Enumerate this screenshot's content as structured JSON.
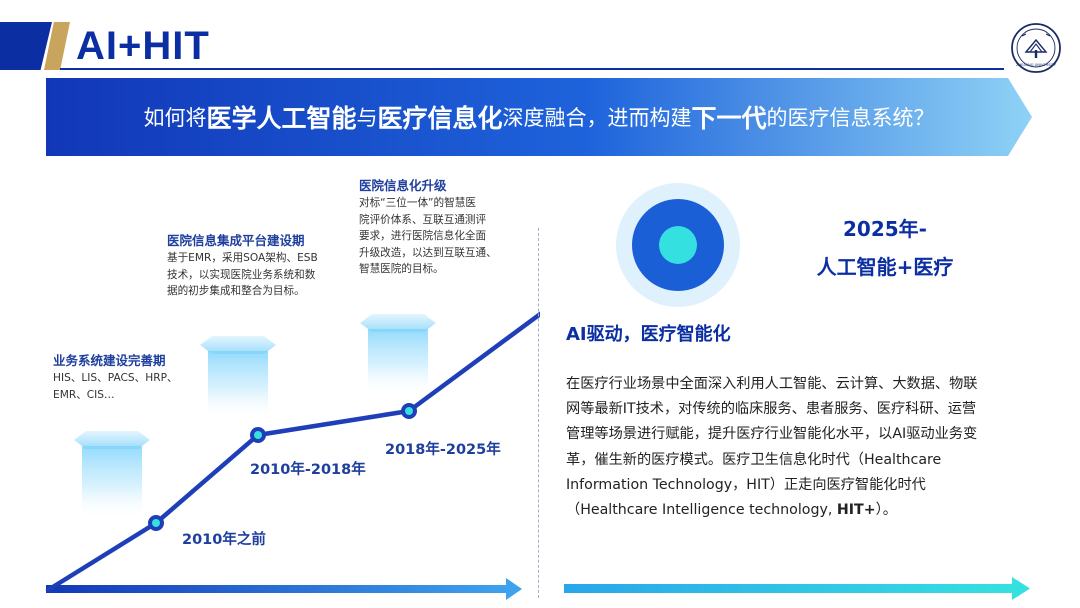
{
  "header": {
    "title": "AI+HIT",
    "logo_text": "ZHEJIANG UNIVERSITY"
  },
  "banner": {
    "parts": [
      {
        "text": "如何将",
        "strong": false
      },
      {
        "text": "医学人工智能",
        "strong": true
      },
      {
        "text": "与",
        "strong": false
      },
      {
        "text": "医疗信息化",
        "strong": true
      },
      {
        "text": "深度融合，进而构建",
        "strong": false
      },
      {
        "text": "下一代",
        "strong": true
      },
      {
        "text": "的医疗信息系统？",
        "strong": false
      }
    ]
  },
  "stages": [
    {
      "title": "业务系统建设完善期",
      "desc_lines": [
        "HIS、LIS、PACS、HRP、",
        "EMR、CIS…"
      ],
      "period": "2010年之前",
      "level": 1
    },
    {
      "title": "医院信息集成平台建设期",
      "desc_lines": [
        "基于EMR，采用SOA架构、ESB",
        "技术，以实现医院业务系统和数",
        "据的初步集成和整合为目标。"
      ],
      "period": "2010年-2018年",
      "level": 2
    },
    {
      "title": "医院信息化升级",
      "desc_lines": [
        "对标“三位一体”的智慧医",
        "院评价体系、互联互通测评",
        "要求，进行医院信息化全面",
        "升级改造，以达到互联互通、",
        "智慧医院的目标。"
      ],
      "period": "2018年-2025年",
      "level": 3
    }
  ],
  "future": {
    "year": "2025年-",
    "name": "人工智能+医疗",
    "subtitle": "AI驱动，医疗智能化",
    "paragraph_lines": [
      "在医疗行业场景中全面深入利用人工智能、云计算、大数据、物联",
      "网等最新IT技术，对传统的临床服务、患者服务、医疗科研、运营",
      "管理等场景进行赋能，提升医疗行业智能化水平，以AI驱动业务变",
      "革，催生新的医疗模式。医疗卫生信息化时代（Healthcare",
      "Information Technology，HIT）正走向医疗智能化时代",
      "（Healthcare Intelligence technology, "
    ],
    "paragraph_bold_tail": "HIT+",
    "paragraph_end": "）。"
  },
  "colors": {
    "primary": "#0b2ea3",
    "accent": "#c9a45c",
    "cyan": "#35e0e0",
    "line": "#1e3fb8"
  }
}
